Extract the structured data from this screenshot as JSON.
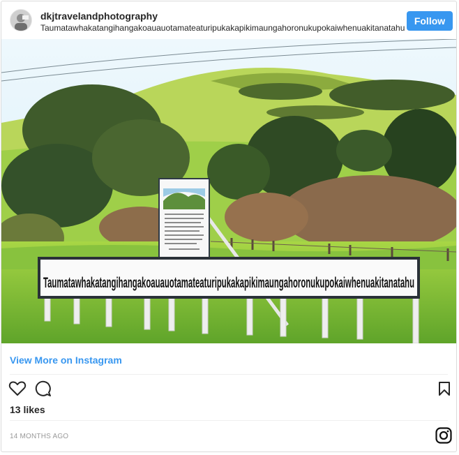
{
  "post": {
    "username": "dkjtravelandphotography",
    "location": "Taumatawhakatangihangakoauauotamateaturipukakapikimaungahoronukupokaiwhenuakitanatahu",
    "follow_label": "Follow",
    "photo": {
      "sign_text": "Taumatawhakatangihangakoauauotamateaturipukakapikimaungahoronukupokaiwhenuakitanatahu"
    },
    "view_more_label": "View More on Instagram",
    "likes": "13 likes",
    "timestamp": "14 MONTHS AGO"
  },
  "icons": {
    "like": "heart-icon",
    "comment": "comment-icon",
    "save": "bookmark-icon",
    "instagram": "instagram-icon"
  },
  "colors": {
    "accent": "#3897f0",
    "text": "#262626",
    "muted": "#999999",
    "border": "#dbdbdb"
  }
}
